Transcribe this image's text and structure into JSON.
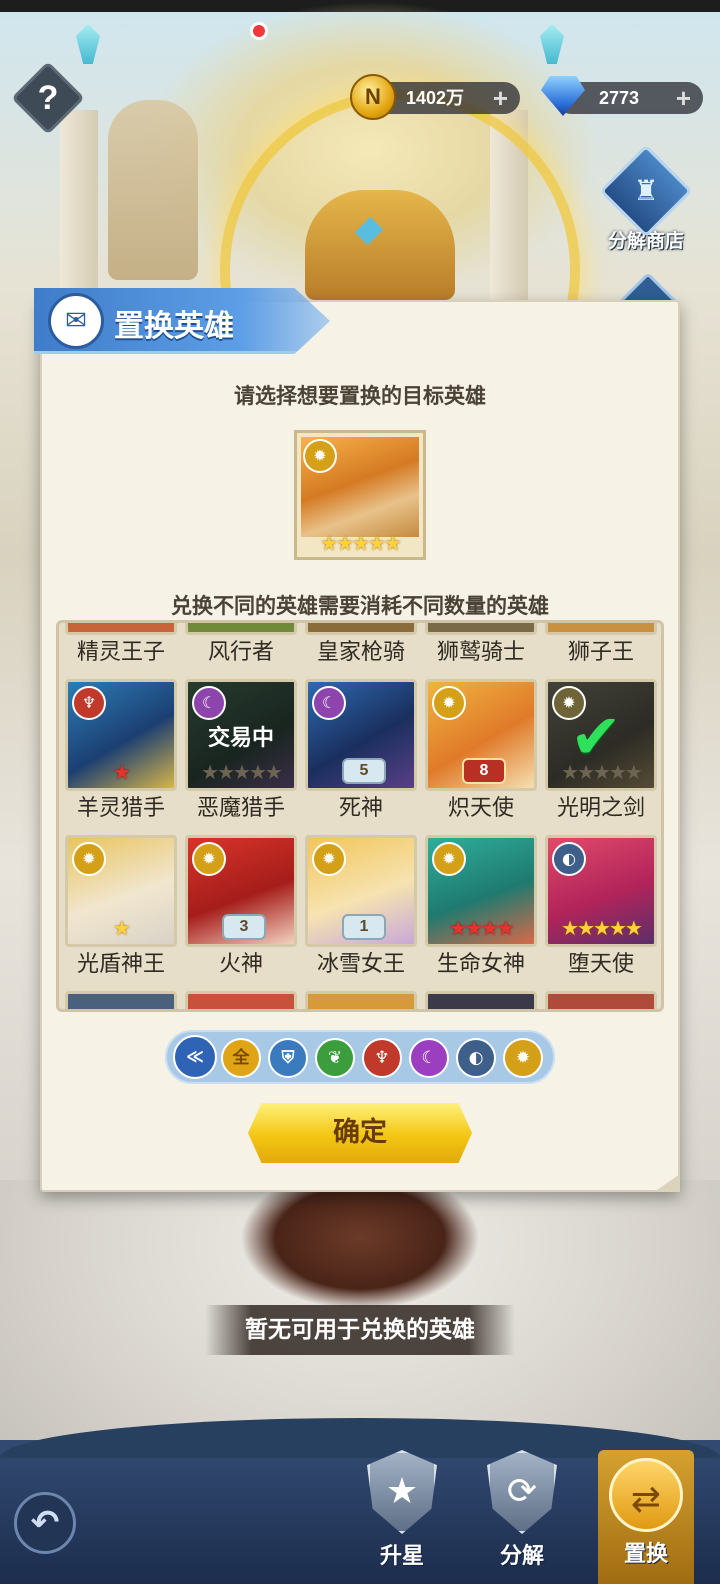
{
  "currency": {
    "gold": {
      "value": "1402万",
      "icon": "coin-icon",
      "symbol": "N"
    },
    "diamond": {
      "value": "2773",
      "icon": "diamond-icon"
    }
  },
  "help_label": "?",
  "side_menu": {
    "shop_label": "分解商店"
  },
  "dialog": {
    "title": "置换英雄",
    "prompt": "请选择想要置换的目标英雄",
    "target_stars": "★★★★★",
    "note": "兑换不同的英雄需要消耗不同数量的英雄",
    "confirm_label": "确定"
  },
  "heroes": [
    {
      "name": "精灵王子"
    },
    {
      "name": "风行者"
    },
    {
      "name": "皇家枪骑"
    },
    {
      "name": "狮鹫骑士"
    },
    {
      "name": "狮子王"
    },
    {
      "name": "羊灵猎手",
      "element": "demon",
      "stars": "★",
      "star_color": "red",
      "color": "#c0392b"
    },
    {
      "name": "恶魔猎手",
      "element": "shadow",
      "stars": "★★★★★",
      "star_color": "gold",
      "status": "交易中",
      "color": "#8e44ad"
    },
    {
      "name": "死神",
      "element": "shadow",
      "rank": "5",
      "color": "#8e44ad"
    },
    {
      "name": "炽天使",
      "element": "light",
      "rank": "8",
      "rank_style": "red",
      "color": "#d4a017"
    },
    {
      "name": "光明之剑",
      "element": "light",
      "stars": "★★★★★",
      "star_color": "gold",
      "selected": true,
      "color": "#d4a017"
    },
    {
      "name": "光盾神王",
      "element": "light",
      "stars": "★",
      "star_color": "gold",
      "color": "#d4a017"
    },
    {
      "name": "火神",
      "element": "light",
      "rank": "3",
      "color": "#d4a017"
    },
    {
      "name": "冰雪女王",
      "element": "light",
      "rank": "1",
      "color": "#d4a017"
    },
    {
      "name": "生命女神",
      "element": "light",
      "stars": "★★★★",
      "star_color": "red",
      "color": "#d4a017"
    },
    {
      "name": "堕天使",
      "element": "dark",
      "stars": "★★★★★",
      "star_color": "gold",
      "color": "#3e5f8a"
    }
  ],
  "filters": [
    {
      "id": "collapse",
      "label": "≪",
      "color": "#2f63b5"
    },
    {
      "id": "all",
      "label": "全",
      "color": "#e0a516"
    },
    {
      "id": "helmet",
      "label": "⛨",
      "color": "#3a7bbf"
    },
    {
      "id": "nature",
      "label": "❦",
      "color": "#3c9d3c"
    },
    {
      "id": "demon",
      "label": "♆",
      "color": "#c0392b"
    },
    {
      "id": "shadow",
      "label": "☾",
      "color": "#9b3fc0"
    },
    {
      "id": "dark",
      "label": "◐",
      "color": "#3e5f8a"
    },
    {
      "id": "light",
      "label": "✹",
      "color": "#d4a017"
    }
  ],
  "empty_message": "暂无可用于兑换的英雄",
  "bottom_nav": [
    {
      "label": "升星",
      "icon": "star-shield-icon",
      "glyph": "★"
    },
    {
      "label": "分解",
      "icon": "recycle-shield-icon",
      "glyph": "⟳"
    },
    {
      "label": "置换",
      "icon": "swap-icon",
      "glyph": "⇄",
      "active": true
    }
  ]
}
